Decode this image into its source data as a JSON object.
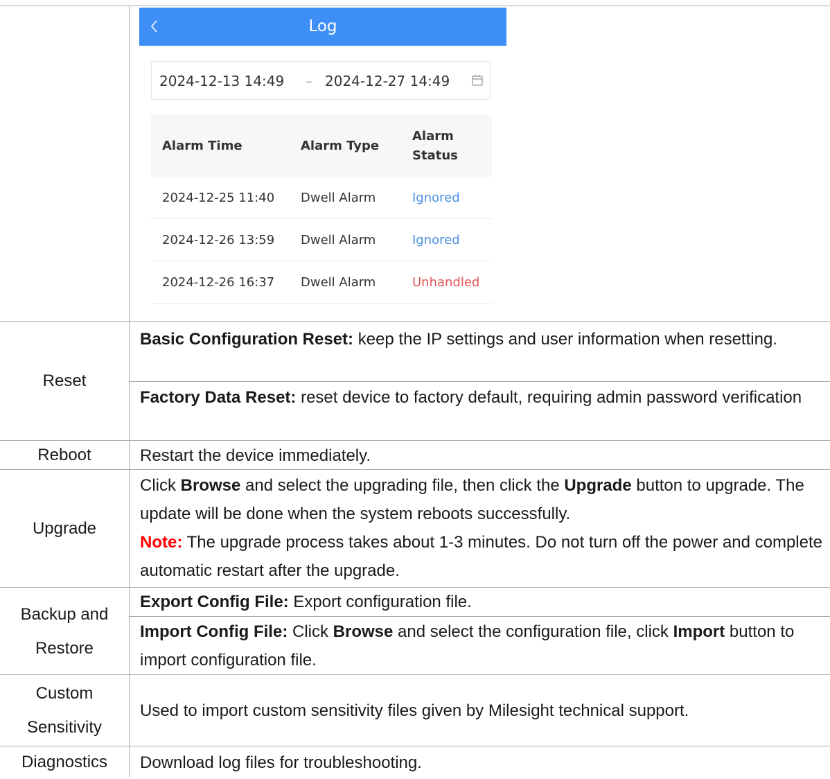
{
  "phone": {
    "title": "Log",
    "date_start": "2024-12-13 14:49",
    "date_sep": "–",
    "date_end": "2024-12-27 14:49",
    "columns": [
      "Alarm Time",
      "Alarm Type",
      "Alarm",
      "Status"
    ],
    "rows": [
      {
        "time": "2024-12-25 11:40",
        "type": "Dwell Alarm",
        "status": "Ignored"
      },
      {
        "time": "2024-12-26 13:59",
        "type": "Dwell Alarm",
        "status": "Ignored"
      },
      {
        "time": "2024-12-26 16:37",
        "type": "Dwell Alarm",
        "status": "Unhandled"
      }
    ]
  },
  "rows": {
    "reset": {
      "label": "Reset",
      "basic_label": "Basic Configuration Reset:",
      "basic_text": " keep the IP settings and user information when resetting.",
      "factory_label": "Factory Data Reset:",
      "factory_text": " reset device to factory default, requiring admin password verification"
    },
    "reboot": {
      "label": "Reboot",
      "text": "Restart the device immediately."
    },
    "upgrade": {
      "label": "Upgrade",
      "t1": "Click ",
      "b1": "Browse",
      "t2": " and select the upgrading file, then click the ",
      "b2": "Upgrade",
      "t3": " button to upgrade. The update will be done when the system reboots successfully.",
      "note_label": "Note:",
      "note_text": " The upgrade process takes about 1-3 minutes. Do not turn off the power and complete automatic restart after the upgrade."
    },
    "backup": {
      "label1": "Backup and",
      "label2": "Restore",
      "export_label": "Export Config File:",
      "export_text": " Export configuration file.",
      "import_label": "Import Config File:",
      "import_t1": " Click ",
      "import_b1": "Browse",
      "import_t2": " and select the configuration file, click ",
      "import_b2": "Import",
      "import_t3": " button to import configuration file."
    },
    "custom": {
      "label1": "Custom",
      "label2": "Sensitivity",
      "text": "Used to import custom sensitivity files given by Milesight technical support."
    },
    "diagnostics": {
      "label": "Diagnostics",
      "text": "Download log files for troubleshooting."
    }
  }
}
